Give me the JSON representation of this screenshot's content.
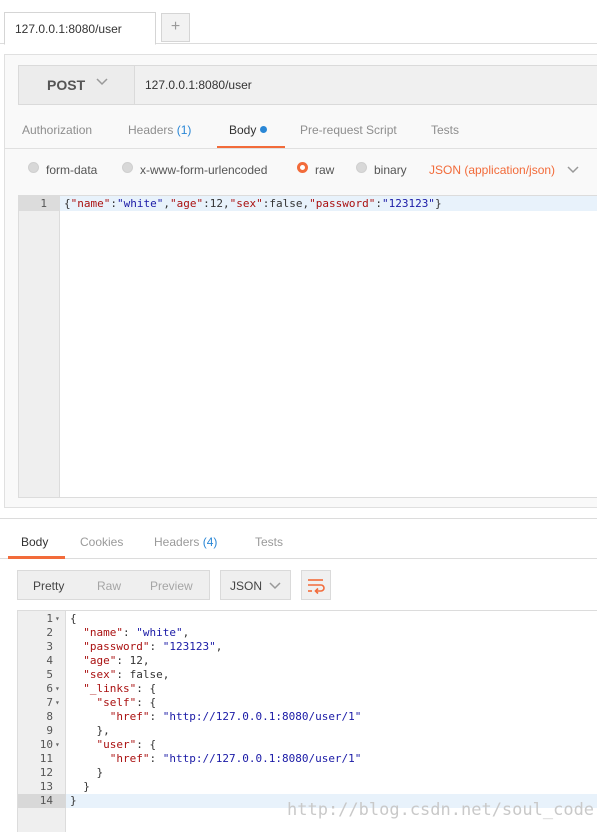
{
  "tab": {
    "title": "127.0.0.1:8080/user",
    "new_tab": "+"
  },
  "request": {
    "method": "POST",
    "url": "127.0.0.1:8080/user",
    "tabs": [
      {
        "label": "Authorization"
      },
      {
        "label": "Headers",
        "count": "(1)"
      },
      {
        "label": "Body"
      },
      {
        "label": "Pre-request Script"
      },
      {
        "label": "Tests"
      }
    ],
    "body_options": [
      "form-data",
      "x-www-form-urlencoded",
      "raw",
      "binary"
    ],
    "selected_option": "raw",
    "content_type": "JSON (application/json)",
    "editor": {
      "line_number": "1",
      "code": "{\"name\":\"white\",\"age\":12,\"sex\":false,\"password\":\"123123\"}"
    }
  },
  "response": {
    "tabs": [
      {
        "label": "Body"
      },
      {
        "label": "Cookies"
      },
      {
        "label": "Headers",
        "count": "(4)"
      },
      {
        "label": "Tests"
      }
    ],
    "view_buttons": [
      "Pretty",
      "Raw",
      "Preview"
    ],
    "format": "JSON",
    "lines": [
      {
        "n": "1",
        "fold": true,
        "text": "{"
      },
      {
        "n": "2",
        "text": "  \"name\": \"white\","
      },
      {
        "n": "3",
        "text": "  \"password\": \"123123\","
      },
      {
        "n": "4",
        "text": "  \"age\": 12,"
      },
      {
        "n": "5",
        "text": "  \"sex\": false,"
      },
      {
        "n": "6",
        "fold": true,
        "text": "  \"_links\": {"
      },
      {
        "n": "7",
        "fold": true,
        "text": "    \"self\": {"
      },
      {
        "n": "8",
        "text": "      \"href\": \"http://127.0.0.1:8080/user/1\""
      },
      {
        "n": "9",
        "text": "    },"
      },
      {
        "n": "10",
        "fold": true,
        "text": "    \"user\": {"
      },
      {
        "n": "11",
        "text": "      \"href\": \"http://127.0.0.1:8080/user/1\""
      },
      {
        "n": "12",
        "text": "    }"
      },
      {
        "n": "13",
        "text": "  }"
      },
      {
        "n": "14",
        "text": "}"
      }
    ]
  },
  "watermark": "http://blog.csdn.net/soul_code",
  "colors": {
    "accent": "#f26b3a",
    "link": "#2a87d6"
  }
}
